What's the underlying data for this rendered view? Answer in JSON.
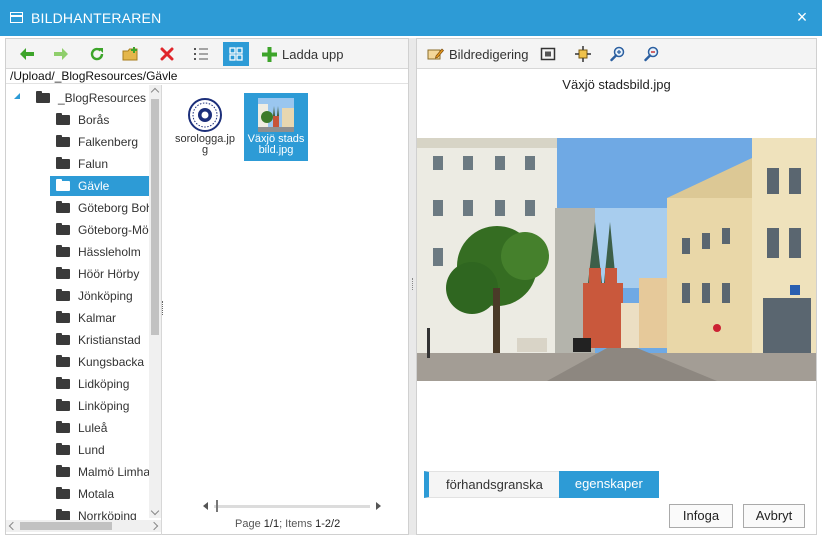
{
  "window": {
    "title": "BILDHANTERAREN",
    "close_glyph": "×"
  },
  "left_toolbar": {
    "icons": [
      "back-arrow-icon",
      "forward-arrow-icon",
      "refresh-icon",
      "new-folder-icon",
      "delete-icon",
      "list-view-icon",
      "thumbnail-view-icon"
    ],
    "upload_label": "Ladda upp"
  },
  "path": "/Upload/_BlogResources/Gävle",
  "tree": {
    "root": "_BlogResources",
    "folders": [
      "Borås",
      "Falkenberg",
      "Falun",
      "Gävle",
      "Göteborg Boh",
      "Göteborg-Mö",
      "Hässleholm",
      "Höör Hörby",
      "Jönköping",
      "Kalmar",
      "Kristianstad",
      "Kungsbacka",
      "Lidköping",
      "Linköping",
      "Luleå",
      "Lund",
      "Malmö Limha",
      "Motala",
      "Norrköping"
    ],
    "selected": "Gävle"
  },
  "files": [
    {
      "name": "sorologga.jpg",
      "selected": false
    },
    {
      "name": "Växjö stadsbild.jpg",
      "selected": true
    }
  ],
  "pager": {
    "page_label": "Page",
    "page": "1/1",
    "items_label": "; Items",
    "items": "1-2/2"
  },
  "right_toolbar": {
    "edit_label": "Bildredigering",
    "icons": [
      "fit-to-window-icon",
      "actual-size-icon",
      "zoom-in-icon",
      "zoom-out-icon"
    ]
  },
  "preview": {
    "filename": "Växjö stadsbild.jpg"
  },
  "tabs": [
    {
      "label": "förhandsgranska",
      "active": false
    },
    {
      "label": "egenskaper",
      "active": true
    }
  ],
  "buttons": {
    "insert": "Infoga",
    "cancel": "Avbryt"
  },
  "colors": {
    "accent": "#2d9bd6",
    "titlebar": "#2d9bd6"
  }
}
